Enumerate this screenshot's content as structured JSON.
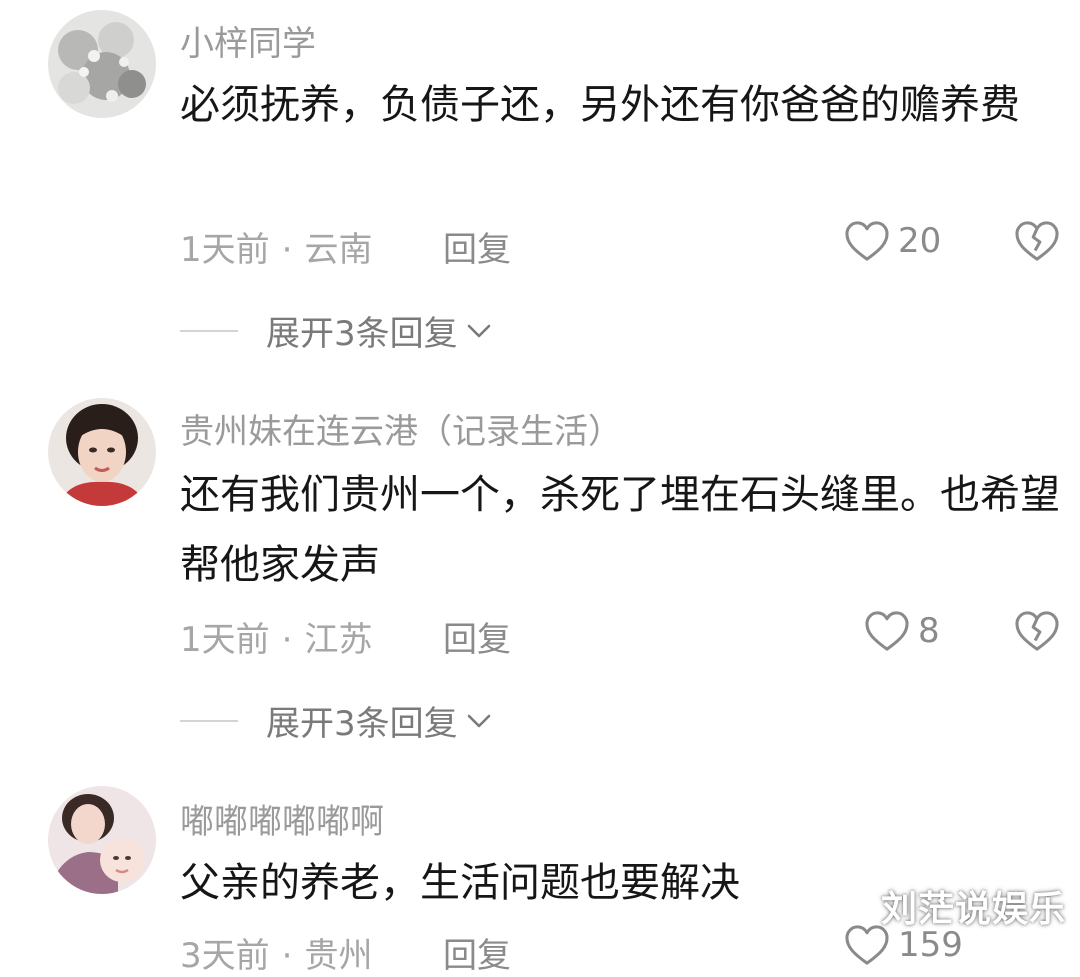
{
  "comments": [
    {
      "username": "小梓同学",
      "content": "必须抚养，负债子还，另外还有你爸爸的赡养费",
      "time": "1天前",
      "location": "云南",
      "reply": "回复",
      "likes": "20",
      "expand": "展开3条回复"
    },
    {
      "username": "贵州妹在连云港（记录生活）",
      "content": "还有我们贵州一个，杀死了埋在石头缝里。也希望帮他家发声",
      "time": "1天前",
      "location": "江苏",
      "reply": "回复",
      "likes": "8",
      "expand": "展开3条回复"
    },
    {
      "username": "嘟嘟嘟嘟嘟啊",
      "content": "父亲的养老，生活问题也要解决",
      "time": "3天前",
      "location": "贵州",
      "reply": "回复",
      "likes": "159"
    }
  ],
  "separator": "·",
  "watermark": "刘茫说娱乐",
  "colors": {
    "text": "#161616",
    "meta": "#a6a6a6",
    "username": "#9a9a9a"
  },
  "icons": {
    "like": "heart-outline-icon",
    "dislike": "broken-heart-icon",
    "expand": "chevron-down-icon"
  }
}
